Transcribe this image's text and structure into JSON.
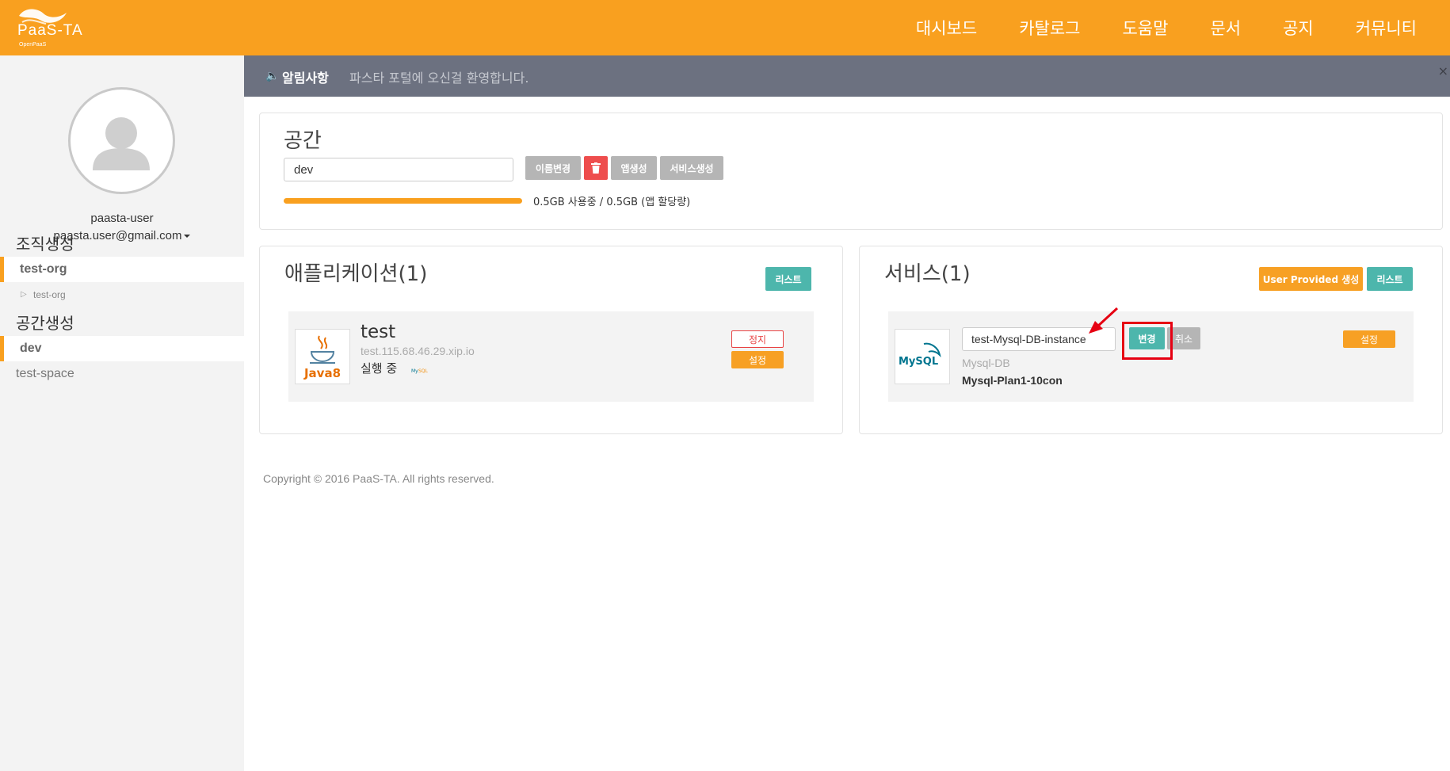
{
  "colors": {
    "brand": "#f9a01f",
    "notice_bg": "#6c7180",
    "teal": "#4db6ac",
    "red": "#ee4d4d",
    "highlight": "#e60012"
  },
  "header": {
    "logo_text": "PaaS-TA",
    "logo_sub": "OpenPaaS",
    "nav": [
      "대시보드",
      "카탈로그",
      "도움말",
      "문서",
      "공지",
      "커뮤니티"
    ]
  },
  "sidebar": {
    "user": {
      "name": "paasta-user",
      "email": "paasta.user@gmail.com"
    },
    "org_section_title": "조직생성",
    "orgs": [
      {
        "label": "test-org",
        "active": true
      },
      {
        "label": "test-org",
        "sub": true
      }
    ],
    "space_section_title": "공간생성",
    "spaces": [
      {
        "label": "dev",
        "active": true
      },
      {
        "label": "test-space",
        "active": false
      }
    ]
  },
  "notice": {
    "title": "알림사항",
    "message": "파스타 포털에 오신걸 환영합니다.",
    "close": "×"
  },
  "space_panel": {
    "title": "공간",
    "name_value": "dev",
    "buttons": {
      "rename": "이름변경",
      "delete_icon": "trash-icon",
      "create_app": "앱생성",
      "create_service": "서비스생성"
    },
    "usage_text": "0.5GB 사용중 / 0.5GB (앱 할당량)",
    "usage_fraction": 1.0
  },
  "apps_panel": {
    "title": "애플리케이션(1)",
    "list_button": "리스트",
    "app": {
      "name": "test",
      "url": "test.115.68.46.29.xip.io",
      "status": "실행 중",
      "thumb_label": "Java8",
      "stop_button": "정지",
      "settings_button": "설정"
    }
  },
  "services_panel": {
    "title": "서비스(1)",
    "user_provided_button": "User Provided 생성",
    "list_button": "리스트",
    "service": {
      "instance_name_value": "test-Mysql-DB-instance",
      "change_button": "변경",
      "cancel_button": "취소",
      "service_type": "Mysql-DB",
      "plan": "Mysql-Plan1-10con",
      "thumb_label": "MySQL",
      "settings_button": "설정"
    }
  },
  "footer": {
    "copyright": "Copyright © 2016 PaaS-TA. All rights reserved."
  }
}
